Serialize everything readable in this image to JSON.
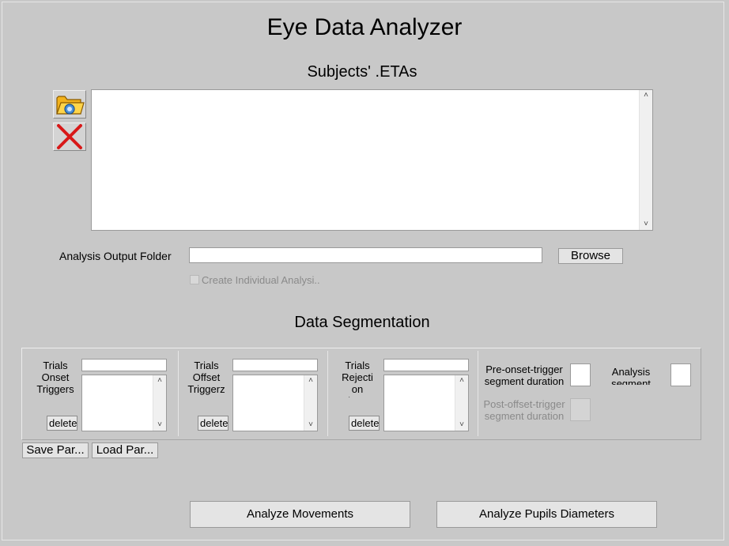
{
  "app": {
    "title": "Eye Data Analyzer"
  },
  "subjects": {
    "heading": "Subjects' .ETAs",
    "add_icon": "folder-open-icon",
    "remove_icon": "red-x-delete-icon",
    "items": []
  },
  "output": {
    "label": "Analysis Output Folder",
    "value": "",
    "browse_label": "Browse",
    "checkbox_label": "Create Individual Analysi..",
    "checkbox_checked": false
  },
  "segmentation": {
    "heading": "Data Segmentation",
    "onset": {
      "label": "Trials Onset Triggers",
      "value": "",
      "delete_label": "delete"
    },
    "offset": {
      "label": "Trials Offset Triggerz",
      "value": "",
      "delete_label": "delete"
    },
    "rejection": {
      "label": "Trials Rejecti on Triggers",
      "value": "",
      "delete_label": "delete"
    },
    "pre_onset": {
      "label": "Pre-onset-trigger segment duration (ms)",
      "value": ""
    },
    "post_offset": {
      "label": "Post-offset-trigger segment duration (ms)",
      "value": ""
    },
    "analysis_segment": {
      "label": "Analysis segment",
      "value": ""
    }
  },
  "params": {
    "save_label": "Save Par...",
    "load_label": "Load Par..."
  },
  "actions": {
    "analyze_movements": "Analyze Movements",
    "analyze_pupils": "Analyze Pupils Diameters"
  }
}
